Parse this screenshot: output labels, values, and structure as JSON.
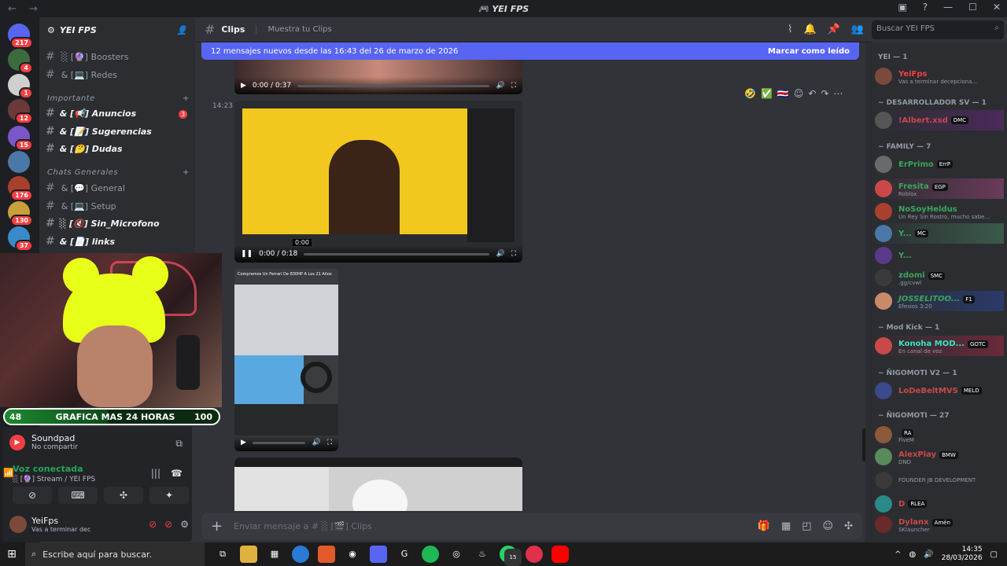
{
  "window": {
    "title": "YEI FPS",
    "nav": "← →"
  },
  "servers": [
    {
      "badge": "217"
    },
    {
      "badge": "4"
    },
    {
      "badge": "1"
    },
    {
      "badge": "12"
    },
    {
      "badge": "15"
    },
    {
      "badge": ""
    },
    {
      "badge": "176"
    },
    {
      "badge": "130"
    },
    {
      "badge": "37"
    }
  ],
  "guild": {
    "name": "YEI FPS",
    "channels": [
      {
        "name": "░ [🔮] Boosters"
      },
      {
        "name": "& [💻] Redes"
      },
      {
        "name": "& [📢] Anuncios",
        "mentions": "3"
      },
      {
        "name": "& [📝] Sugerencias"
      },
      {
        "name": "& [🤔] Dudas"
      },
      {
        "name": "& [💬] General"
      },
      {
        "name": "& [💻] Setup"
      },
      {
        "name": "░ [🔇] Sin_Microfono"
      },
      {
        "name": "& [📄] links"
      }
    ],
    "categories": [
      "Importante",
      "Chats Generales"
    ]
  },
  "overlay": {
    "bar_left": "48",
    "bar_center": "GRAFICA MAS 24 HORAS",
    "bar_right": "100",
    "bar_fill": 0.48
  },
  "activity": {
    "title": "Soundpad",
    "sub": "No compartir"
  },
  "voice": {
    "status": "Voz conectada",
    "channel": "░ [🔮] Stream / YEI FPS"
  },
  "user": {
    "name": "YeiFps",
    "status": "Vas a terminar dec"
  },
  "chat": {
    "channel": "Clips",
    "topic": "Muestra tu Clips",
    "banner": "12 mensajes nuevos desde las 16:43 del 26 de marzo de 2026",
    "banner_action": "Marcar como leído",
    "timestamp": "14:23",
    "video1_time": "0:00 / 0:37",
    "video2_time": "0:00 / 0:18",
    "video2_hover": "0:00",
    "video3_caption": "Compramos Un Ferrari De 830HP A Los 21 Años",
    "composer_placeholder": "Enviar mensaje a # ░ [🎬] Clips",
    "search_placeholder": "Buscar YEI FPS"
  },
  "members": {
    "groups": [
      {
        "label": "YEI — 1"
      },
      {
        "label": "~ DESARROLLADOR SV — 1"
      },
      {
        "label": "~ FAMILY — 7"
      },
      {
        "label": "~ Mod Kick — 1"
      },
      {
        "label": "~ ÑIGOMOTI V2 — 1"
      },
      {
        "label": "~ ÑIGOMOTI — 27"
      }
    ],
    "list": [
      {
        "name": "YeiFps",
        "tag": "",
        "activity": "Vas a terminar decepciona...",
        "color": "#f23f43"
      },
      {
        "name": "!Albert.xsd",
        "tag": "DMC",
        "activity": "",
        "color": "#c94949"
      },
      {
        "name": "ErPrimo",
        "tag": "ErrP",
        "activity": "",
        "color": "#3ba55c"
      },
      {
        "name": "Fresita",
        "tag": "EGP",
        "activity": "Roblox",
        "color": "#3ba55c"
      },
      {
        "name": "NoSoyHeldus",
        "tag": "",
        "activity": "Un Rey Sin Rostro, mucho sabe...",
        "color": "#3ba55c"
      },
      {
        "name": "Y...",
        "tag": "MC",
        "activity": "",
        "color": "#3ba55c"
      },
      {
        "name": "Y...",
        "tag": "",
        "activity": "",
        "color": "#3ba55c"
      },
      {
        "name": "zdomi",
        "tag": "SMC",
        "activity": ".gg/cvwl",
        "color": "#3ba55c"
      },
      {
        "name": "JOSSELITOO...",
        "tag": "F1",
        "activity": "Efesios 3:20",
        "color": "#3ba55c"
      },
      {
        "name": "Konoha MOD...",
        "tag": "GOTC",
        "activity": "En canal de voz",
        "color": "#2ee8c8"
      },
      {
        "name": "LoDeBeltMVS",
        "tag": "MELD",
        "activity": "",
        "color": "#c94949"
      },
      {
        "name": "",
        "tag": "RA",
        "activity": "FiveM",
        "color": "#c94949"
      },
      {
        "name": "AlexPlay",
        "tag": "BMW",
        "activity": "DND",
        "color": "#c94949"
      },
      {
        "name": "",
        "tag": "",
        "activity": "FOUNDER JB DEVELOPMENT",
        "color": "#c94949"
      },
      {
        "name": "D",
        "tag": "RLEA",
        "activity": "",
        "color": "#c94949"
      },
      {
        "name": "Dylanx",
        "tag": "Amén",
        "activity": "SKlauncher",
        "color": "#c94949"
      }
    ]
  },
  "taskbar": {
    "search": "Escribe aquí para buscar.",
    "time": "14:35",
    "date": "28/03/2026",
    "whatsapp_badge": "15"
  }
}
